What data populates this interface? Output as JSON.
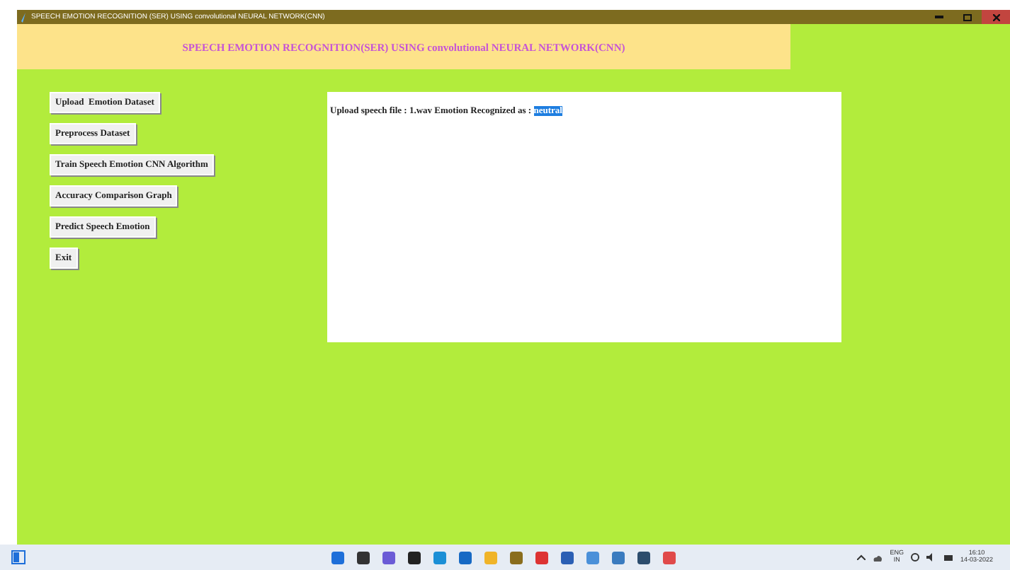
{
  "window": {
    "title": "SPEECH EMOTION RECOGNITION (SER) USING convolutional NEURAL NETWORK(CNN)"
  },
  "header": {
    "title": "SPEECH EMOTION RECOGNITION(SER) USING convolutional NEURAL NETWORK(CNN)"
  },
  "buttons": [
    "Upload  Emotion Dataset",
    "Preprocess Dataset",
    "Train Speech Emotion CNN Algorithm",
    "Accuracy Comparison Graph",
    "Predict Speech Emotion",
    "Exit"
  ],
  "output": {
    "text": "Upload speech file : 1.wav Emotion Recognized as : ",
    "selection": {
      "text": "neutral",
      "selected": true
    }
  },
  "taskbar": {
    "language": "ENG",
    "region": "IN",
    "time": "16:10",
    "date": "14-03-2022"
  }
}
